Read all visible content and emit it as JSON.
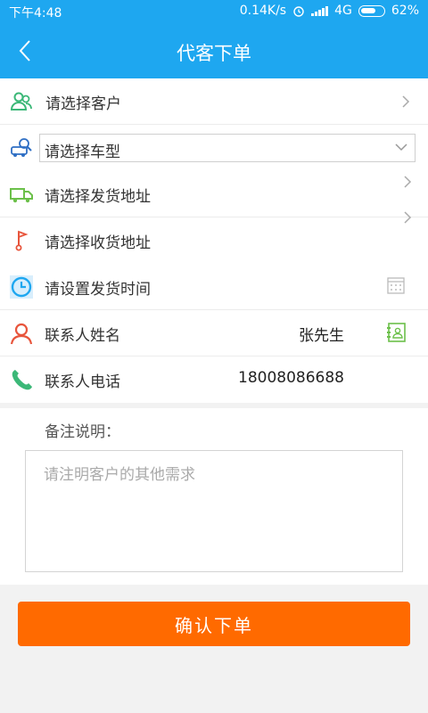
{
  "status": {
    "time": "下午4:48",
    "net_speed": "0.14K/s",
    "network": "4G",
    "battery": "62%"
  },
  "header": {
    "title": "代客下单"
  },
  "form": {
    "customer_label": "请选择客户",
    "vehicle_label": "请选择车型",
    "ship_from_label": "请选择发货地址",
    "ship_to_label": "请选择收货地址",
    "ship_time_label": "请设置发货时间",
    "contact_name_label": "联系人姓名",
    "contact_name_value": "张先生",
    "contact_phone_label": "联系人电话",
    "contact_phone_value": "18008086688"
  },
  "remark": {
    "label": "备注说明：",
    "placeholder": "请注明客户的其他需求"
  },
  "confirm_label": "确认下单",
  "colors": {
    "primary_blue": "#1ea7f0",
    "confirm_orange": "#ff6a00",
    "icon_green": "#3cb878",
    "icon_red": "#e8553c"
  }
}
